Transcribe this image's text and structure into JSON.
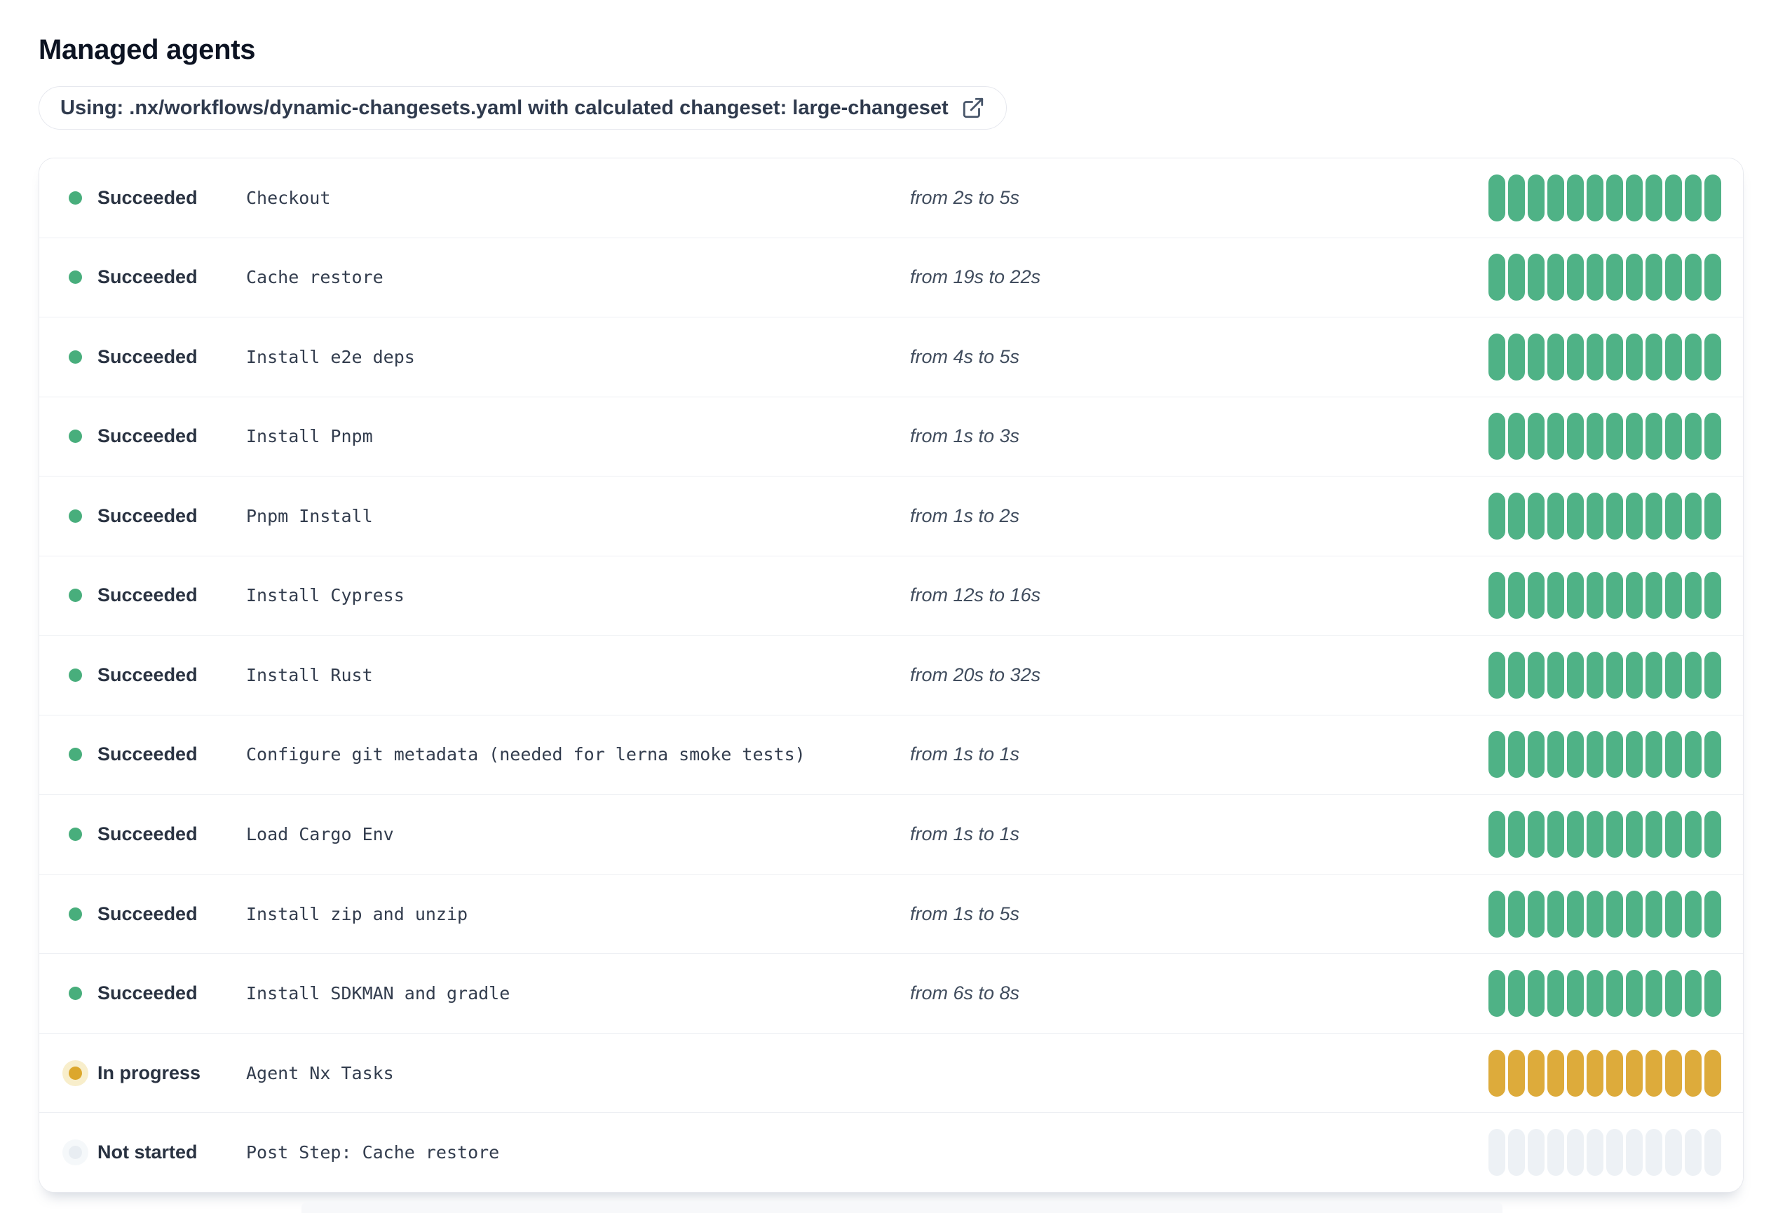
{
  "page": {
    "title": "Managed agents"
  },
  "workflow_banner": {
    "text": "Using: .nx/workflows/dynamic-changesets.yaml with calculated changeset: large-changeset",
    "icon": "external-link-icon",
    "icon_color": "#475569"
  },
  "agents": {
    "bar_segments": 12,
    "statuses": {
      "succeeded": {
        "label": "Succeeded",
        "dot_color": "#48ae7c",
        "bar_color": "#4fb286"
      },
      "in_progress": {
        "label": "In progress",
        "dot_color": "#dca72c",
        "halo_color": "#f8eecb",
        "bar_color": "#ddab3b"
      },
      "not_started": {
        "label": "Not started",
        "dot_color": "#e8edf2",
        "halo_color": "#f5f8fa",
        "bar_color": "#edf1f5"
      }
    },
    "rows": [
      {
        "status": "succeeded",
        "status_label": "Succeeded",
        "name": "Checkout",
        "duration": "from 2s to 5s"
      },
      {
        "status": "succeeded",
        "status_label": "Succeeded",
        "name": "Cache restore",
        "duration": "from 19s to 22s"
      },
      {
        "status": "succeeded",
        "status_label": "Succeeded",
        "name": "Install e2e deps",
        "duration": "from 4s to 5s"
      },
      {
        "status": "succeeded",
        "status_label": "Succeeded",
        "name": "Install Pnpm",
        "duration": "from 1s to 3s"
      },
      {
        "status": "succeeded",
        "status_label": "Succeeded",
        "name": "Pnpm Install",
        "duration": "from 1s to 2s"
      },
      {
        "status": "succeeded",
        "status_label": "Succeeded",
        "name": "Install Cypress",
        "duration": "from 12s to 16s"
      },
      {
        "status": "succeeded",
        "status_label": "Succeeded",
        "name": "Install Rust",
        "duration": "from 20s to 32s"
      },
      {
        "status": "succeeded",
        "status_label": "Succeeded",
        "name": "Configure git metadata (needed for lerna smoke tests)",
        "duration": "from 1s to 1s"
      },
      {
        "status": "succeeded",
        "status_label": "Succeeded",
        "name": "Load Cargo Env",
        "duration": "from 1s to 1s"
      },
      {
        "status": "succeeded",
        "status_label": "Succeeded",
        "name": "Install zip and unzip",
        "duration": "from 1s to 5s"
      },
      {
        "status": "succeeded",
        "status_label": "Succeeded",
        "name": "Install SDKMAN and gradle",
        "duration": "from 6s to 8s"
      },
      {
        "status": "in_progress",
        "status_label": "In progress",
        "name": "Agent Nx Tasks",
        "duration": ""
      },
      {
        "status": "not_started",
        "status_label": "Not started",
        "name": "Post Step: Cache restore",
        "duration": ""
      }
    ]
  }
}
